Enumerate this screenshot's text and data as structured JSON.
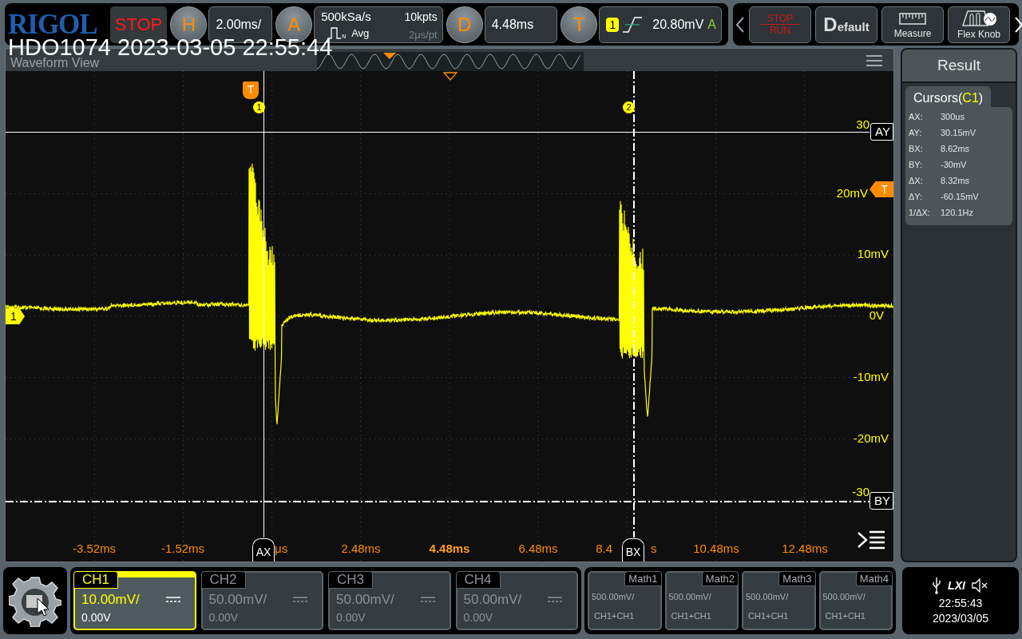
{
  "header": {
    "logo": "RIGOL",
    "run_state": "STOP"
  },
  "horizontal": {
    "key": "H",
    "scale": "2.00ms/"
  },
  "acquisition": {
    "key": "A",
    "sample_rate": "500kSa/s",
    "memory_depth": "10kpts",
    "mode_badge": "N",
    "mode": "Avg",
    "resolution": "2μs/pt"
  },
  "delay": {
    "key": "D",
    "value": "4.48ms"
  },
  "trigger": {
    "key": "T",
    "source": "1",
    "voltage": "20.80mV",
    "sweep": "A"
  },
  "toolbar": [
    {
      "kind": "stop_run",
      "label": "STOP",
      "sublabel": "RUN"
    },
    {
      "kind": "default",
      "label": "Default"
    },
    {
      "kind": "measure",
      "label": "Measure"
    },
    {
      "kind": "flex_knob",
      "label": "Flex Knob"
    }
  ],
  "capture_title": "HDO1074 2023-03-05 22:55:44",
  "waveform_view": {
    "title": "Waveform View",
    "trigger_marker": "T",
    "trigger_level_marker": "T",
    "channel_marker": "1",
    "cursor_tags": [
      "1",
      "2"
    ],
    "cursors": [
      {
        "name": "AY",
        "kind": "y"
      },
      {
        "name": "BY",
        "kind": "y"
      },
      {
        "name": "AX",
        "kind": "x"
      },
      {
        "name": "BX",
        "kind": "x"
      }
    ],
    "y_labels": [
      "30",
      "20mV",
      "10mV",
      "0V",
      "-10mV",
      "-20mV",
      "-30"
    ],
    "x_labels": [
      {
        "text": "-3.52ms",
        "kind": "tick"
      },
      {
        "text": "-1.52ms",
        "kind": "tick"
      },
      {
        "text": "μs",
        "kind": "tick"
      },
      {
        "text": "2.48ms",
        "kind": "tick"
      },
      {
        "text": "4.48ms",
        "kind": "center"
      },
      {
        "text": "6.48ms",
        "kind": "tick"
      },
      {
        "text": "8.4",
        "kind": "tick"
      },
      {
        "text": "s",
        "kind": "tick"
      },
      {
        "text": "10.48ms",
        "kind": "tick"
      },
      {
        "text": "12.48ms",
        "kind": "tick"
      }
    ]
  },
  "result": {
    "title": "Result",
    "tab_prefix": "Cursors(",
    "tab_source": "C1",
    "tab_suffix": ")",
    "rows": [
      {
        "name": "AX:",
        "value": "300us"
      },
      {
        "name": "AY:",
        "value": "30.15mV"
      },
      {
        "name": "BX:",
        "value": "8.62ms"
      },
      {
        "name": "BY:",
        "value": "-30mV"
      },
      {
        "name": "ΔX:",
        "value": "8.32ms"
      },
      {
        "name": "ΔY:",
        "value": "-60.15mV"
      },
      {
        "name": "1/ΔX:",
        "value": "120.1Hz"
      }
    ]
  },
  "channels": [
    {
      "name": "CH1",
      "scale": "10.00mV/",
      "offset": "0.00V",
      "selected": true
    },
    {
      "name": "CH2",
      "scale": "50.00mV/",
      "offset": "0.00V",
      "selected": false
    },
    {
      "name": "CH3",
      "scale": "50.00mV/",
      "offset": "0.00V",
      "selected": false
    },
    {
      "name": "CH4",
      "scale": "50.00mV/",
      "offset": "0.00V",
      "selected": false
    }
  ],
  "maths": [
    {
      "name": "Math1",
      "scale": "500.00mV/",
      "source": "CH1+CH1"
    },
    {
      "name": "Math2",
      "scale": "500.00mV/",
      "source": "CH1+CH1"
    },
    {
      "name": "Math3",
      "scale": "500.00mV/",
      "source": "CH1+CH1"
    },
    {
      "name": "Math4",
      "scale": "500.00mV/",
      "source": "CH1+CH1"
    }
  ],
  "status": {
    "lxi": "LXI",
    "time": "22:55:43",
    "date": "2023/03/05"
  }
}
